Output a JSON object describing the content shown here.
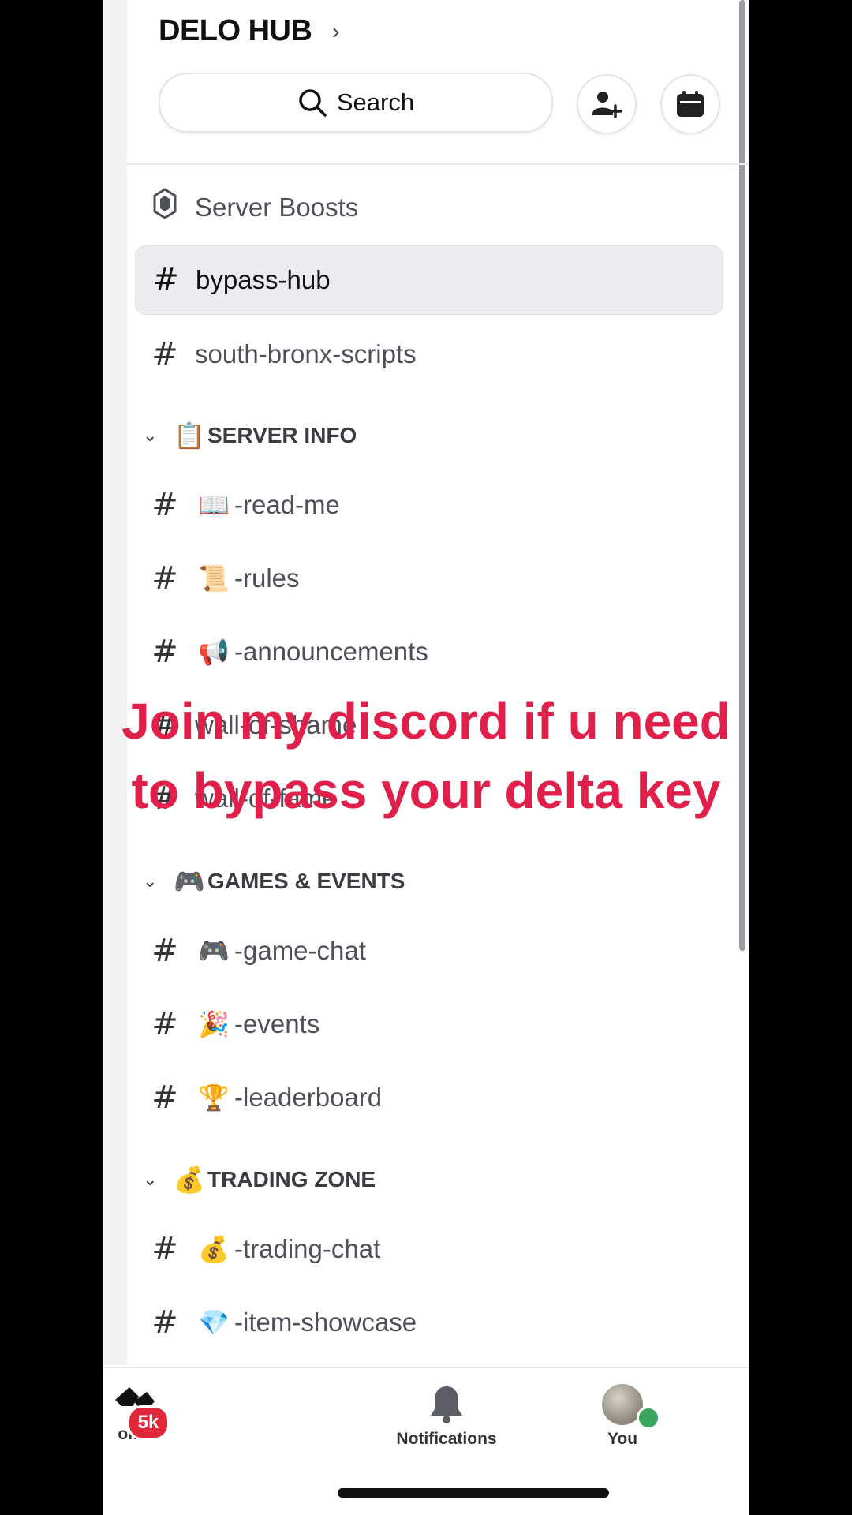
{
  "server": {
    "name": "DELO HUB",
    "chevron": "›"
  },
  "header": {
    "search_label": "Search"
  },
  "channels_top": [
    {
      "name": "Server Boosts",
      "icon": "boost-icon"
    },
    {
      "name": "bypass-hub",
      "selected": true
    },
    {
      "name": "south-bronx-scripts"
    }
  ],
  "categories": [
    {
      "label": "SERVER INFO",
      "emoji": "📋",
      "channels": [
        {
          "emoji": "📖",
          "name": "-read-me"
        },
        {
          "emoji": "📜",
          "name": "-rules"
        },
        {
          "emoji": "📢",
          "name": "-announcements"
        },
        {
          "emoji": "",
          "name": "wall-of-shame"
        },
        {
          "emoji": "",
          "name": "wall-of-fame"
        }
      ]
    },
    {
      "label": "GAMES & EVENTS",
      "emoji": "🎮",
      "channels": [
        {
          "emoji": "🎮",
          "name": "-game-chat"
        },
        {
          "emoji": "🎉",
          "name": "-events"
        },
        {
          "emoji": "🏆",
          "name": "-leaderboard"
        }
      ]
    },
    {
      "label": "TRADING ZONE",
      "emoji": "💰",
      "channels": [
        {
          "emoji": "💰",
          "name": "-trading-chat"
        },
        {
          "emoji": "💎",
          "name": "-item-showcase"
        }
      ]
    }
  ],
  "overlay": {
    "line1": "Join my discord if u need",
    "line2": "to bypass your delta key",
    "color": "#e0204a"
  },
  "tabs": {
    "home_label": "ome",
    "home_badge": "5k",
    "notifications_label": "Notifications",
    "you_label": "You"
  },
  "colors": {
    "badge": "#e0283a",
    "online": "#3ba55d",
    "selected_row": "#ebecef"
  }
}
